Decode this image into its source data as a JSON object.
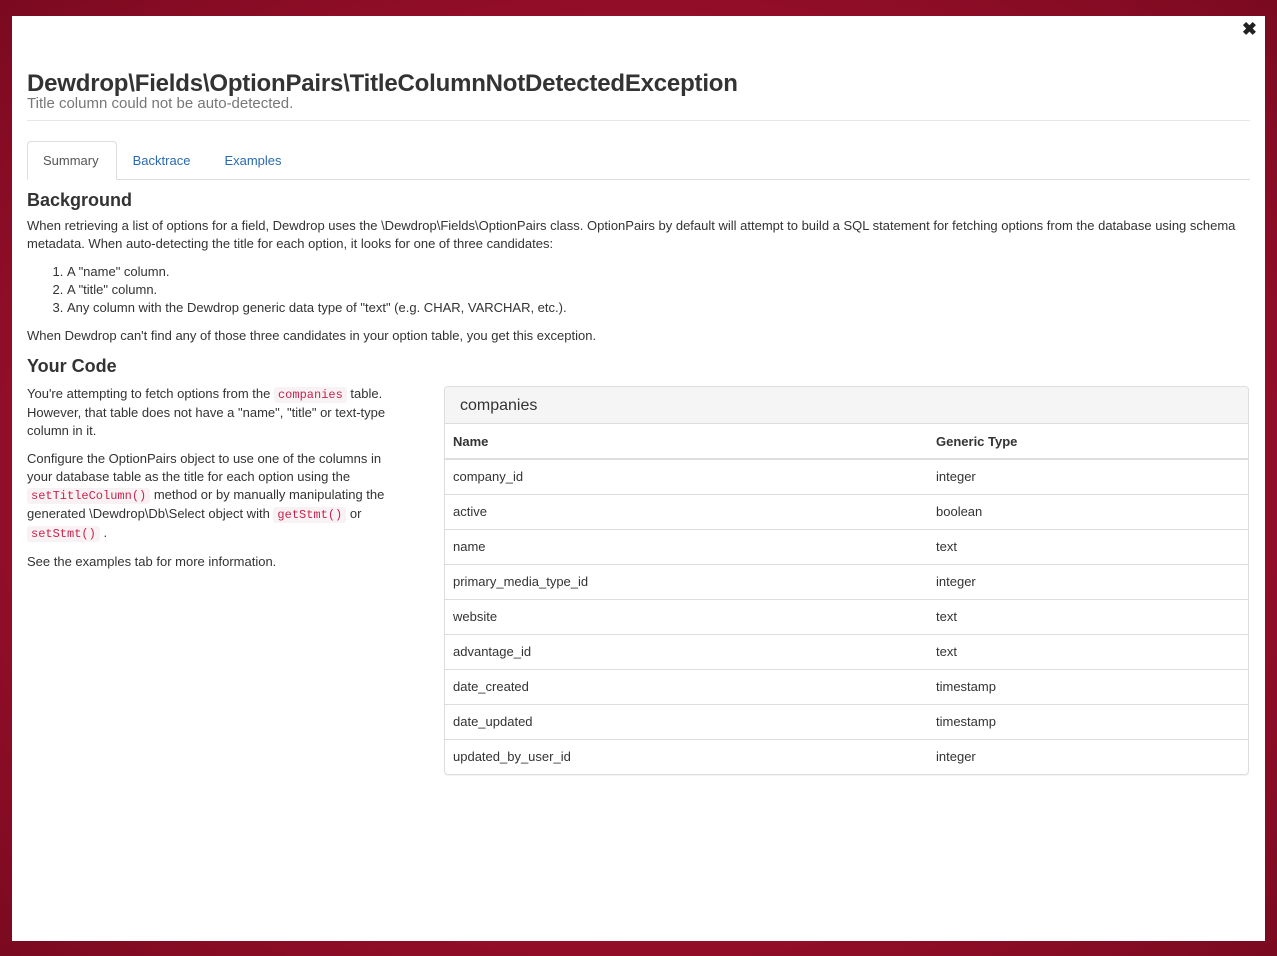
{
  "modal": {
    "close_label": "✖"
  },
  "header": {
    "title": "Dewdrop\\Fields\\OptionPairs\\TitleColumnNotDetectedException",
    "subtitle": "Title column could not be auto-detected."
  },
  "tabs": [
    {
      "label": "Summary",
      "active": true
    },
    {
      "label": "Backtrace",
      "active": false
    },
    {
      "label": "Examples",
      "active": false
    }
  ],
  "background": {
    "heading": "Background",
    "paragraph": "When retrieving a list of options for a field, Dewdrop uses the \\Dewdrop\\Fields\\OptionPairs class. OptionPairs by default will attempt to build a SQL statement for fetching options from the database using schema metadata. When auto-detecting the title for each option, it looks for one of three candidates:",
    "candidates": [
      "A \"name\" column.",
      "A \"title\" column.",
      "Any column with the Dewdrop generic data type of \"text\" (e.g. CHAR, VARCHAR, etc.)."
    ],
    "conclusion": "When Dewdrop can't find any of those three candidates in your option table, you get this exception."
  },
  "your_code": {
    "heading": "Your Code",
    "p1_before": "You're attempting to fetch options from the ",
    "p1_code": "companies",
    "p1_after": " table. However, that table does not have a \"name\", \"title\" or text-type column in it.",
    "p2_part1": "Configure the OptionPairs object to use one of the columns in your database table as the title for each option using the ",
    "p2_code1": "setTitleColumn()",
    "p2_part2": " method or by manually manipulating the generated \\Dewdrop\\Db\\Select object with ",
    "p2_code2": "getStmt()",
    "p2_part3": " or ",
    "p2_code3": "setStmt()",
    "p2_part4": ".",
    "p3": "See the examples tab for more information."
  },
  "table_panel": {
    "title": "companies",
    "headers": [
      "Name",
      "Generic Type"
    ],
    "rows": [
      [
        "company_id",
        "integer"
      ],
      [
        "active",
        "boolean"
      ],
      [
        "name",
        "text"
      ],
      [
        "primary_media_type_id",
        "integer"
      ],
      [
        "website",
        "text"
      ],
      [
        "advantage_id",
        "text"
      ],
      [
        "date_created",
        "timestamp"
      ],
      [
        "date_updated",
        "timestamp"
      ],
      [
        "updated_by_user_id",
        "integer"
      ]
    ]
  }
}
